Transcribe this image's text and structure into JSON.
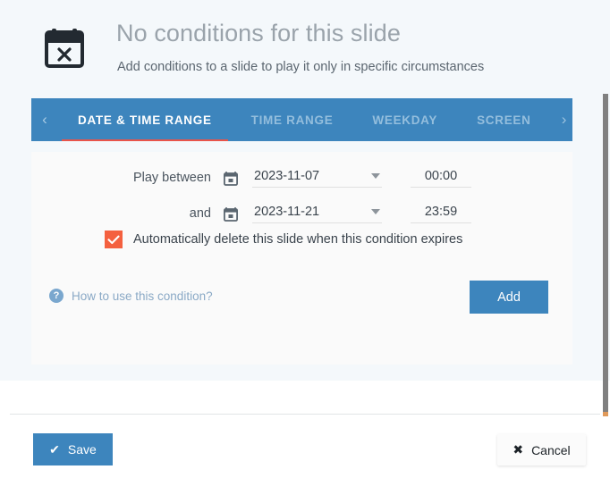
{
  "header": {
    "icon": "calendar-x-icon",
    "title": "No conditions for this slide",
    "subtitle": "Add conditions to a slide to play it only in specific circumstances"
  },
  "tabs": {
    "prev_arrow": "‹",
    "next_arrow": "›",
    "items": [
      {
        "label": "DATE & TIME RANGE",
        "active": true
      },
      {
        "label": "TIME RANGE",
        "active": false
      },
      {
        "label": "WEEKDAY",
        "active": false
      },
      {
        "label": "SCREEN",
        "active": false
      }
    ]
  },
  "condition_form": {
    "from_row": {
      "label": "Play between",
      "calendar_icon": "calendar-icon",
      "date": "2023-11-07",
      "time": "00:00"
    },
    "to_row": {
      "label": "and",
      "calendar_icon": "calendar-icon",
      "date": "2023-11-21",
      "time": "23:59"
    },
    "auto_delete": {
      "checked": true,
      "check_glyph": "✓",
      "label": "Automatically delete this slide when this condition expires"
    },
    "help": {
      "icon_glyph": "?",
      "text": "How to use this condition?"
    },
    "add_label": "Add"
  },
  "footer": {
    "save_label": "Save",
    "save_glyph": "✔",
    "cancel_label": "Cancel",
    "cancel_glyph": "✖"
  },
  "colors": {
    "accent_blue": "#3d85bd",
    "active_tab_underline": "#e8544a",
    "checkbox_orange": "#f4603f",
    "page_background": "#f4f8fb",
    "panel_background": "#fafafa",
    "help_link": "#8aa9c6"
  }
}
